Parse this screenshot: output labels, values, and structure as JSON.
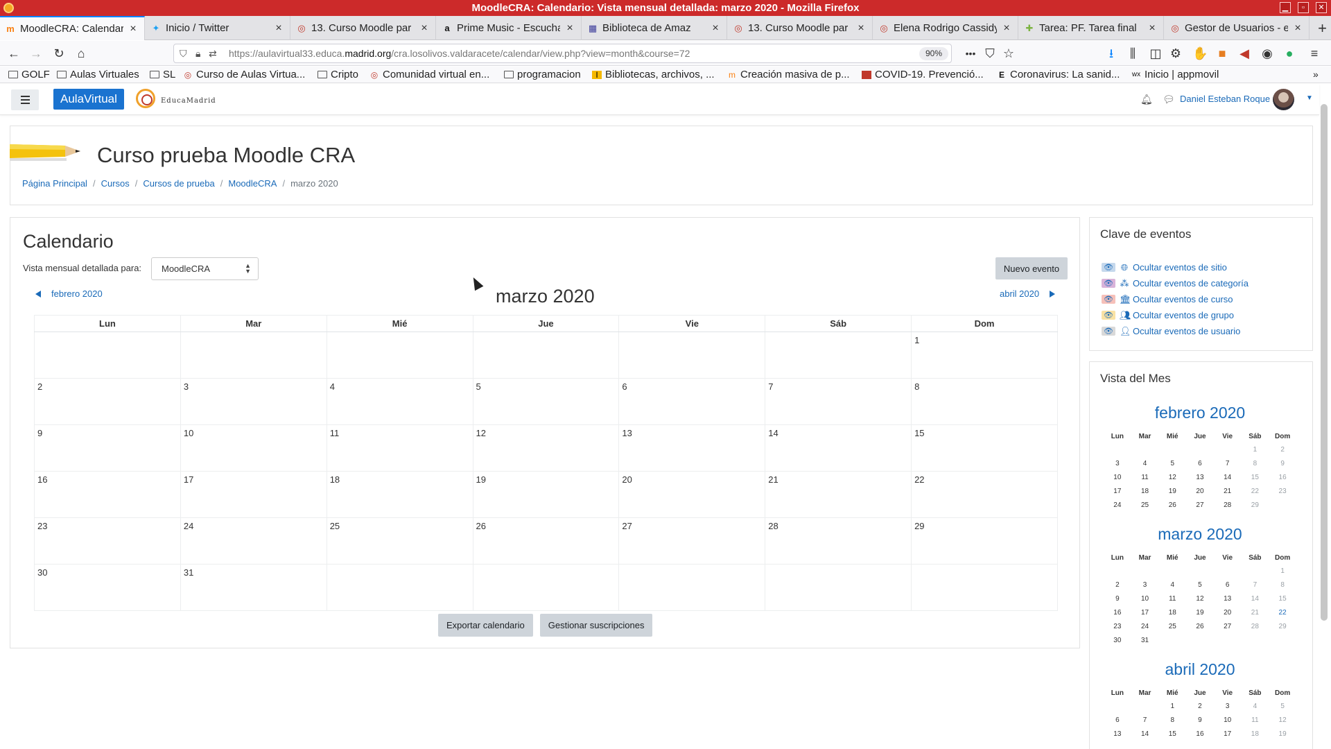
{
  "window": {
    "title": "MoodleCRA: Calendario: Vista mensual detallada: marzo 2020 - Mozilla Firefox"
  },
  "tabs": [
    {
      "label": "MoodleCRA: Calendar",
      "icon": "moodle-icon",
      "active": true
    },
    {
      "label": "Inicio / Twitter",
      "icon": "twitter-icon",
      "active": false
    },
    {
      "label": "13. Curso Moodle par",
      "icon": "educamadrid-icon",
      "active": false
    },
    {
      "label": "Prime Music - Escucha",
      "icon": "amazon-icon",
      "active": false
    },
    {
      "label": "Biblioteca de Amaz",
      "icon": "bookmark-icon",
      "active": false
    },
    {
      "label": "13. Curso Moodle par",
      "icon": "educamadrid-icon",
      "active": false
    },
    {
      "label": "Elena Rodrigo Cassidy",
      "icon": "educamadrid-icon",
      "active": false
    },
    {
      "label": "Tarea: PF. Tarea final",
      "icon": "task-icon",
      "active": false
    },
    {
      "label": "Gestor de Usuarios - e",
      "icon": "educamadrid-icon",
      "active": false
    }
  ],
  "address_bar": {
    "url_prefix": "https://aulavirtual33.educa.",
    "url_domain": "madrid.org",
    "url_suffix": "/cra.losolivos.valdaracete/calendar/view.php?view=month&course=72",
    "zoom": "90%"
  },
  "bookmarks": [
    {
      "label": "GOLF",
      "icon": "folder-icon"
    },
    {
      "label": "Aulas Virtuales",
      "icon": "folder-icon"
    },
    {
      "label": "SL",
      "icon": "folder-icon"
    },
    {
      "label": "Curso de Aulas Virtua...",
      "icon": "educamadrid-icon"
    },
    {
      "label": "Cripto",
      "icon": "folder-icon"
    },
    {
      "label": "Comunidad virtual en...",
      "icon": "educamadrid-icon"
    },
    {
      "label": "programacion",
      "icon": "folder-icon"
    },
    {
      "label": "Bibliotecas, archivos, ...",
      "icon": "library-icon"
    },
    {
      "label": "Creación masiva de p...",
      "icon": "moodle-icon"
    },
    {
      "label": "COVID-19. Prevenció...",
      "icon": "flag-icon"
    },
    {
      "label": "Coronavirus: La sanid...",
      "icon": "news-icon"
    },
    {
      "label": "Inicio | appmovil",
      "icon": "app-icon"
    }
  ],
  "moodle_nav": {
    "brand": "AulaVirtual",
    "logo_text": "EducaMadrid",
    "user_name": "Daniel Esteban Roque"
  },
  "page_header": {
    "course_title": "Curso prueba Moodle CRA",
    "breadcrumb": [
      "Página Principal",
      "Cursos",
      "Cursos de prueba",
      "MoodleCRA",
      "marzo 2020"
    ]
  },
  "calendar": {
    "heading": "Calendario",
    "view_label": "Vista mensual detallada para:",
    "selected_course": "MoodleCRA",
    "new_event_button": "Nuevo evento",
    "prev_month": "febrero 2020",
    "next_month": "abril 2020",
    "month_title": "marzo 2020",
    "weekdays": [
      "Lun",
      "Mar",
      "Mié",
      "Jue",
      "Vie",
      "Sáb",
      "Dom"
    ],
    "weeks": [
      [
        "",
        "",
        "",
        "",
        "",
        "",
        "1"
      ],
      [
        "2",
        "3",
        "4",
        "5",
        "6",
        "7",
        "8"
      ],
      [
        "9",
        "10",
        "11",
        "12",
        "13",
        "14",
        "15"
      ],
      [
        "16",
        "17",
        "18",
        "19",
        "20",
        "21",
        "22"
      ],
      [
        "23",
        "24",
        "25",
        "26",
        "27",
        "28",
        "29"
      ],
      [
        "30",
        "31",
        "",
        "",
        "",
        "",
        ""
      ]
    ],
    "export_button": "Exportar calendario",
    "subscriptions_button": "Gestionar suscripciones"
  },
  "event_key": {
    "title": "Clave de eventos",
    "items": [
      {
        "label": "Ocultar eventos de sitio",
        "icon": "globe-icon",
        "color": "#c5d8ec"
      },
      {
        "label": "Ocultar eventos de categoría",
        "icon": "cubes-icon",
        "color": "#d9b3d9"
      },
      {
        "label": "Ocultar eventos de curso",
        "icon": "institution-icon",
        "color": "#f6c0b9"
      },
      {
        "label": "Ocultar eventos de grupo",
        "icon": "group-icon",
        "color": "#f9e2a4"
      },
      {
        "label": "Ocultar eventos de usuario",
        "icon": "user-icon",
        "color": "#d9d9d9"
      }
    ]
  },
  "month_view": {
    "title": "Vista del Mes",
    "weekdays": [
      "Lun",
      "Mar",
      "Mié",
      "Jue",
      "Vie",
      "Sáb",
      "Dom"
    ],
    "months": [
      {
        "name": "febrero 2020",
        "weeks": [
          [
            "",
            "",
            "",
            "",
            "",
            "1",
            "2"
          ],
          [
            "3",
            "4",
            "5",
            "6",
            "7",
            "8",
            "9"
          ],
          [
            "10",
            "11",
            "12",
            "13",
            "14",
            "15",
            "16"
          ],
          [
            "17",
            "18",
            "19",
            "20",
            "21",
            "22",
            "23"
          ],
          [
            "24",
            "25",
            "26",
            "27",
            "28",
            "29",
            ""
          ]
        ]
      },
      {
        "name": "marzo 2020",
        "weeks": [
          [
            "",
            "",
            "",
            "",
            "",
            "",
            "1"
          ],
          [
            "2",
            "3",
            "4",
            "5",
            "6",
            "7",
            "8"
          ],
          [
            "9",
            "10",
            "11",
            "12",
            "13",
            "14",
            "15"
          ],
          [
            "16",
            "17",
            "18",
            "19",
            "20",
            "21",
            "22"
          ],
          [
            "23",
            "24",
            "25",
            "26",
            "27",
            "28",
            "29"
          ],
          [
            "30",
            "31",
            "",
            "",
            "",
            "",
            ""
          ]
        ],
        "highlighted_day": "22"
      },
      {
        "name": "abril 2020",
        "weeks": [
          [
            "",
            "",
            "1",
            "2",
            "3",
            "4",
            "5"
          ],
          [
            "6",
            "7",
            "8",
            "9",
            "10",
            "11",
            "12"
          ],
          [
            "13",
            "14",
            "15",
            "16",
            "17",
            "18",
            "19"
          ]
        ]
      }
    ]
  },
  "colors": {
    "accent": "#1a73d0",
    "link": "#1a6ab8",
    "titlebar": "#cc2a2a",
    "button_grey": "#ced4da"
  }
}
